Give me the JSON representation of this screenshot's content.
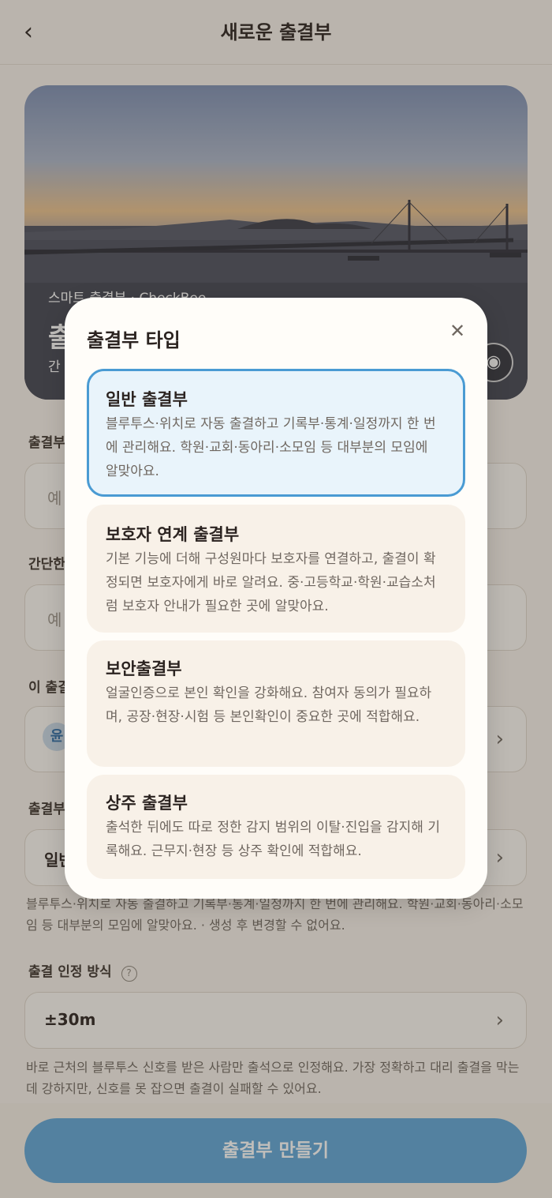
{
  "header": {
    "back_icon": "chevron-left-icon",
    "title": "새로운 출결부"
  },
  "hero": {
    "subtitle": "스마트 출결부 · CheckBee",
    "title": "출",
    "description": "간",
    "camera_icon": "camera-icon"
  },
  "form": {
    "name_label": "출결부",
    "name_placeholder": "예",
    "desc_label": "간단한",
    "desc_placeholder": "예",
    "owner_label": "이 출결",
    "owner_badge": "윤",
    "type_label": "출결부",
    "type_value": "일반",
    "type_help": "블루투스·위치로 자동 출결하고 기록부·통계·일정까지 한 번에 관리해요. 학원·교회·동아리·소모임 등 대부분의 모임에 알맞아요. · 생성 후 변경할 수 없어요.",
    "method_label": "출결 인정 방식",
    "method_value": "±30m",
    "method_help": "바로 근처의 블루투스 신호를 받은 사람만 출석으로 인정해요. 가장 정확하고 대리 출결을 막는 데 강하지만, 신호를 못 잡으면 출결이 실패할 수 있어요."
  },
  "create_button": "출결부 만들기",
  "modal": {
    "title": "출결부 타입",
    "close_icon": "close-icon",
    "options": [
      {
        "title": "일반 출결부",
        "description": "블루투스·위치로 자동 출결하고 기록부·통계·일정까지 한 번에 관리해요. 학원·교회·동아리·소모임 등 대부분의 모임에 알맞아요.",
        "selected": true
      },
      {
        "title": "보호자 연계 출결부",
        "description": "기본 기능에 더해 구성원마다 보호자를 연결하고, 출결이 확정되면 보호자에게 바로 알려요. 중·고등학교·학원·교습소처럼 보호자 안내가 필요한 곳에 알맞아요.",
        "selected": false
      },
      {
        "title": "보안출결부",
        "description": "얼굴인증으로 본인 확인을 강화해요. 참여자 동의가 필요하며, 공장·현장·시험 등 본인확인이 중요한 곳에 적합해요.",
        "selected": false
      },
      {
        "title": "상주 출결부",
        "description": "출석한 뒤에도 따로 정한 감지 범위의 이탈·진입을 감지해 기록해요. 근무지·현장 등 상주 확인에 적합해요.",
        "selected": false
      }
    ]
  },
  "colors": {
    "accent": "#4a9bd3",
    "button": "#5fa5d7",
    "selected_bg": "#e9f4fb",
    "option_bg": "#f8f1e8"
  }
}
